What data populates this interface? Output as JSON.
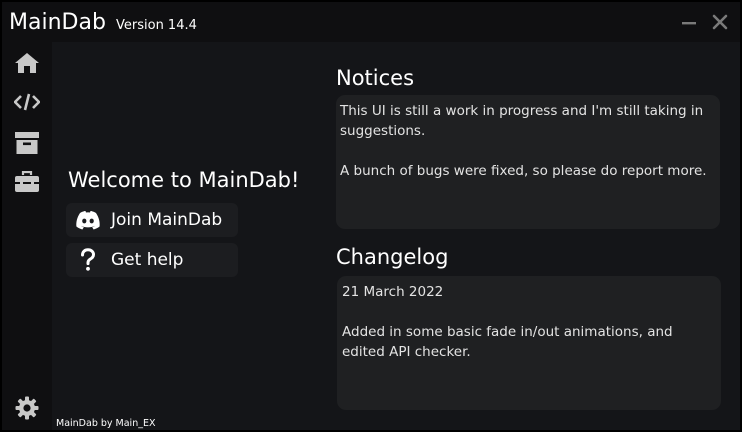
{
  "window": {
    "title": "MainDab",
    "version": "Version 14.4",
    "minimize_icon": "minimize-icon",
    "close_icon": "close-icon"
  },
  "sidebar": {
    "items": [
      {
        "icon": "home-icon"
      },
      {
        "icon": "code-icon"
      },
      {
        "icon": "archive-icon"
      },
      {
        "icon": "toolbox-icon"
      },
      {
        "icon": "gear-icon"
      }
    ]
  },
  "home": {
    "welcome": "Welcome to MainDab!",
    "buttons": [
      {
        "label": "Join MainDab",
        "icon": "discord-icon"
      },
      {
        "label": "Get help",
        "icon": "question-icon"
      }
    ]
  },
  "notices": {
    "title": "Notices",
    "lines": [
      "This UI is still a work in progress and I'm still taking in suggestions.",
      "A bunch of bugs were fixed, so please do report more."
    ]
  },
  "changelog": {
    "title": "Changelog",
    "date": "21 March 2022",
    "text": "Added in some basic fade in/out animations, and edited API checker."
  },
  "footer": "MainDab by Main_EX",
  "colors": {
    "background": "#141518",
    "sidebar": "#0f0f11",
    "panel": "#1f2022",
    "button": "#1c1d20",
    "icon": "#c8c8c8",
    "text": "#ffffff"
  }
}
